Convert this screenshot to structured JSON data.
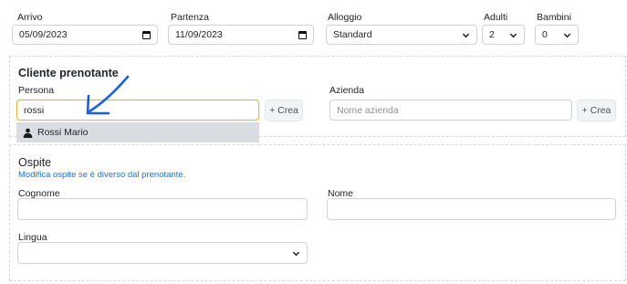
{
  "booking": {
    "arrivo": {
      "label": "Arrivo",
      "value": "05/09/2023"
    },
    "partenza": {
      "label": "Partenza",
      "value": "11/09/2023"
    },
    "alloggio": {
      "label": "Alloggio",
      "value": "Standard"
    },
    "adulti": {
      "label": "Adulti",
      "value": "2"
    },
    "bambini": {
      "label": "Bambini",
      "value": "0"
    }
  },
  "cliente": {
    "title": "Cliente prenotante",
    "persona_label": "Persona",
    "persona_value": "rossi",
    "crea_label": "+ Crea",
    "suggestion": "Rossi Mario",
    "azienda_label": "Azienda",
    "azienda_placeholder": "Nome azienda"
  },
  "ospite": {
    "title": "Ospite",
    "hint": "Modifica ospite se è diverso dal prenotante.",
    "cognome_label": "Cognome",
    "nome_label": "Nome",
    "lingua_label": "Lingua"
  },
  "icons": {
    "calendar": "calendar-icon",
    "chevron": "chevron-down-icon",
    "user": "user-icon",
    "arrow": "arrow-annotation"
  },
  "colors": {
    "focus": "#f2b233",
    "link": "#1a73e8",
    "arrow": "#1a5fe8"
  }
}
